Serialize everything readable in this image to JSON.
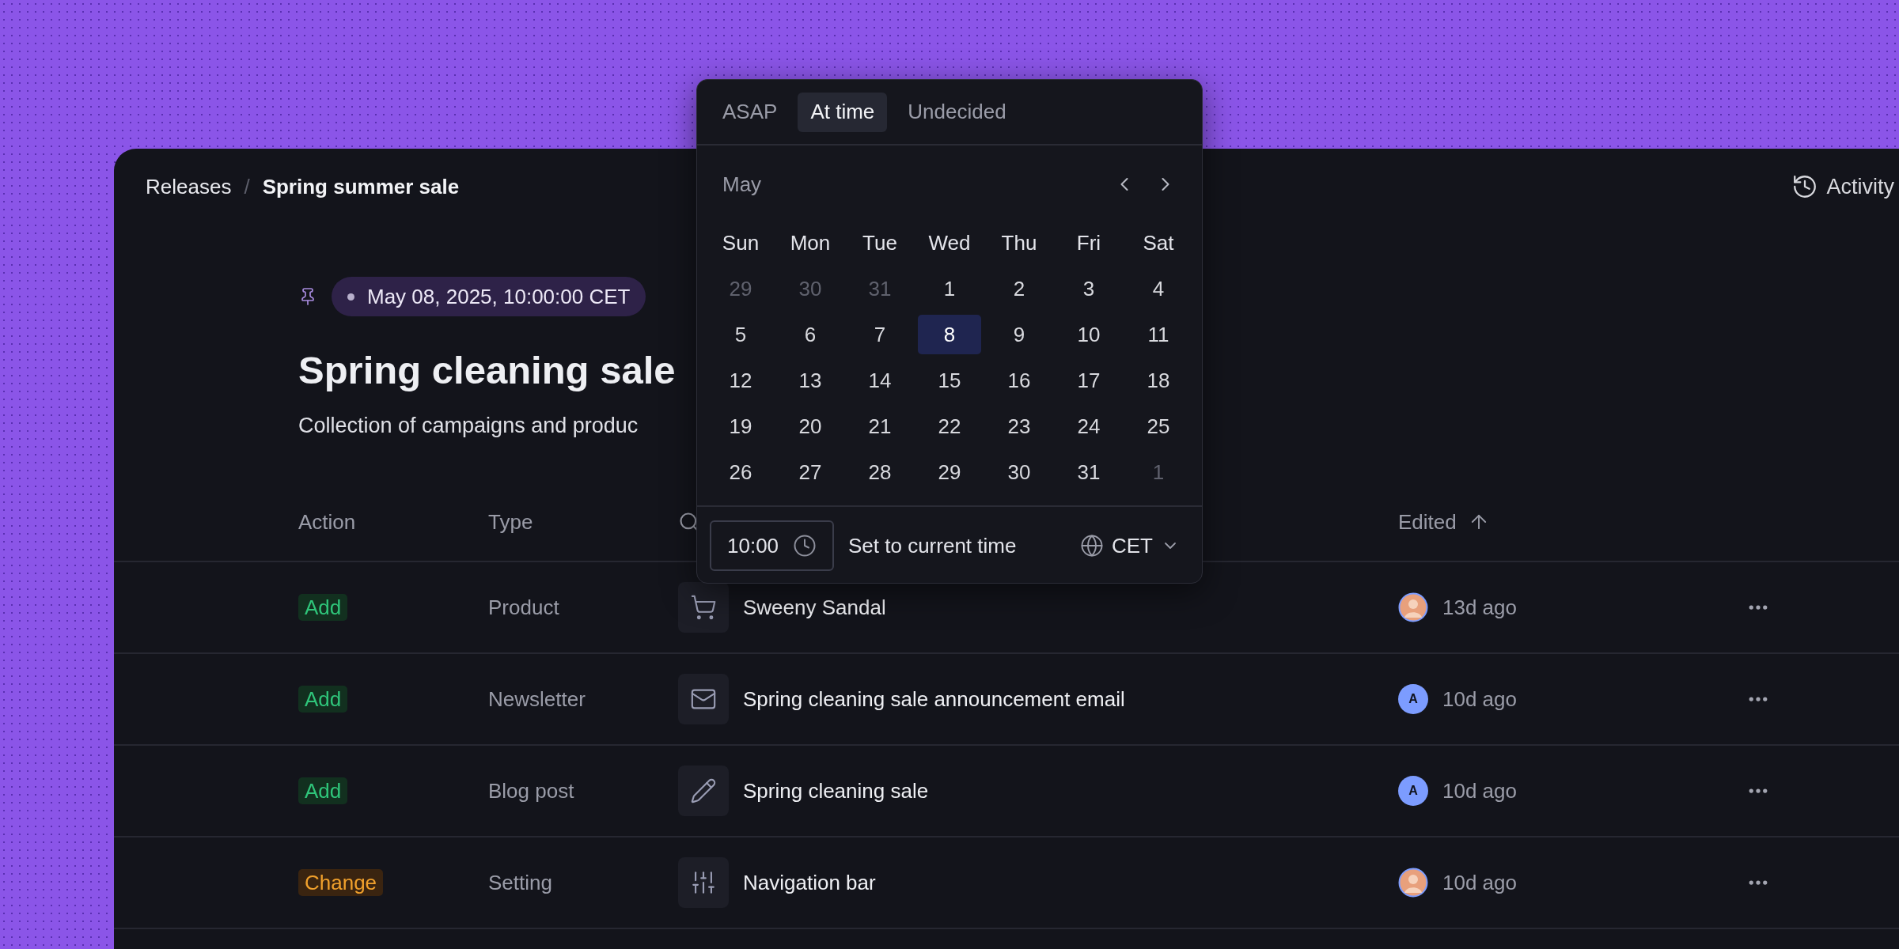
{
  "breadcrumb": {
    "parent": "Releases",
    "separator": "/",
    "current": "Spring summer sale"
  },
  "activity": "Activity",
  "release": {
    "date": "May 08, 2025, 10:00:00 CET",
    "title": "Spring cleaning sale",
    "description": "Collection of campaigns and produc"
  },
  "table": {
    "columns": [
      {
        "label": "Action",
        "kind": "text"
      },
      {
        "label": "Type",
        "kind": "text"
      },
      {
        "kind": "search"
      },
      {
        "label": "Edited",
        "kind": "sorted"
      }
    ],
    "rows": [
      {
        "action": {
          "label": "Add",
          "kind": "add"
        },
        "type": "Product",
        "name": "Sweeny Sandal",
        "avatar": {
          "kind": "photo"
        },
        "edited": "13d ago"
      },
      {
        "action": {
          "label": "Add",
          "kind": "add"
        },
        "type": "Newsletter",
        "name": "Spring cleaning sale announcement email",
        "avatar": {
          "kind": "initial",
          "initial": "A"
        },
        "edited": "10d ago"
      },
      {
        "action": {
          "label": "Add",
          "kind": "add"
        },
        "type": "Blog post",
        "name": "Spring cleaning sale",
        "avatar": {
          "kind": "initial",
          "initial": "A"
        },
        "edited": "10d ago"
      },
      {
        "action": {
          "label": "Change",
          "kind": "change"
        },
        "type": "Setting",
        "name": "Navigation bar",
        "avatar": {
          "kind": "photo"
        },
        "edited": "10d ago"
      }
    ]
  },
  "popover": {
    "tabs": [
      {
        "label": "ASAP",
        "selected": false
      },
      {
        "label": "At time",
        "selected": true
      },
      {
        "label": "Undecided",
        "selected": false
      }
    ],
    "month": "May",
    "weekdays": [
      "Sun",
      "Mon",
      "Tue",
      "Wed",
      "Thu",
      "Fri",
      "Sat"
    ],
    "days": [
      {
        "label": "29",
        "outside": true,
        "selected": false
      },
      {
        "label": "30",
        "outside": true,
        "selected": false
      },
      {
        "label": "31",
        "outside": true,
        "selected": false
      },
      {
        "label": "1",
        "outside": false,
        "selected": false
      },
      {
        "label": "2",
        "outside": false,
        "selected": false
      },
      {
        "label": "3",
        "outside": false,
        "selected": false
      },
      {
        "label": "4",
        "outside": false,
        "selected": false
      },
      {
        "label": "5",
        "outside": false,
        "selected": false
      },
      {
        "label": "6",
        "outside": false,
        "selected": false
      },
      {
        "label": "7",
        "outside": false,
        "selected": false
      },
      {
        "label": "8",
        "outside": false,
        "selected": true
      },
      {
        "label": "9",
        "outside": false,
        "selected": false
      },
      {
        "label": "10",
        "outside": false,
        "selected": false
      },
      {
        "label": "11",
        "outside": false,
        "selected": false
      },
      {
        "label": "12",
        "outside": false,
        "selected": false
      },
      {
        "label": "13",
        "outside": false,
        "selected": false
      },
      {
        "label": "14",
        "outside": false,
        "selected": false
      },
      {
        "label": "15",
        "outside": false,
        "selected": false
      },
      {
        "label": "16",
        "outside": false,
        "selected": false
      },
      {
        "label": "17",
        "outside": false,
        "selected": false
      },
      {
        "label": "18",
        "outside": false,
        "selected": false
      },
      {
        "label": "19",
        "outside": false,
        "selected": false
      },
      {
        "label": "20",
        "outside": false,
        "selected": false
      },
      {
        "label": "21",
        "outside": false,
        "selected": false
      },
      {
        "label": "22",
        "outside": false,
        "selected": false
      },
      {
        "label": "23",
        "outside": false,
        "selected": false
      },
      {
        "label": "24",
        "outside": false,
        "selected": false
      },
      {
        "label": "25",
        "outside": false,
        "selected": false
      },
      {
        "label": "26",
        "outside": false,
        "selected": false
      },
      {
        "label": "27",
        "outside": false,
        "selected": false
      },
      {
        "label": "28",
        "outside": false,
        "selected": false
      },
      {
        "label": "29",
        "outside": false,
        "selected": false
      },
      {
        "label": "30",
        "outside": false,
        "selected": false
      },
      {
        "label": "31",
        "outside": false,
        "selected": false
      },
      {
        "label": "1",
        "outside": true,
        "selected": false
      }
    ],
    "time": "10:00",
    "current_time": "Set to current time",
    "timezone": "CET"
  }
}
